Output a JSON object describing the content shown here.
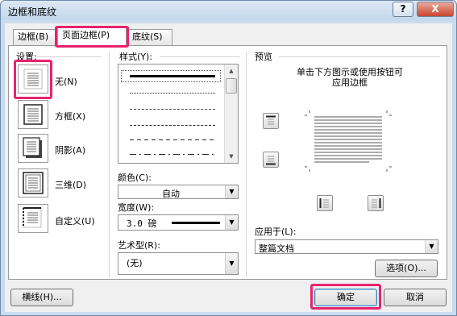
{
  "window": {
    "title": "边框和底纹",
    "help_label": "?",
    "close_label": "X"
  },
  "tabs": [
    {
      "label": "边框(B)"
    },
    {
      "label": "页面边框(P)"
    },
    {
      "label": "底纹(S)"
    }
  ],
  "settings": {
    "title": "设置:",
    "items": [
      {
        "label": "无(N)"
      },
      {
        "label": "方框(X)"
      },
      {
        "label": "阴影(A)"
      },
      {
        "label": "三维(D)"
      },
      {
        "label": "自定义(U)"
      }
    ],
    "selected": "无(N)"
  },
  "style": {
    "title": "样式(Y):",
    "options": [
      "solid",
      "dotted",
      "dash-dot-dot",
      "dashed-fine",
      "dashed",
      "dash-dot"
    ]
  },
  "color": {
    "label": "颜色(C):",
    "value": "自动"
  },
  "width": {
    "label": "宽度(W):",
    "value": "3.0 磅"
  },
  "art": {
    "label": "艺术型(R):",
    "value": "(无)"
  },
  "preview": {
    "title": "预览",
    "hint_line1": "单击下方图示或使用按钮可",
    "hint_line2": "应用边框"
  },
  "apply_to": {
    "label": "应用于(L):",
    "value": "整篇文档"
  },
  "buttons": {
    "options": "选项(O)...",
    "horizontal_line": "横线(H)...",
    "ok": "确定",
    "cancel": "取消"
  },
  "highlight_color": "#e8236d"
}
